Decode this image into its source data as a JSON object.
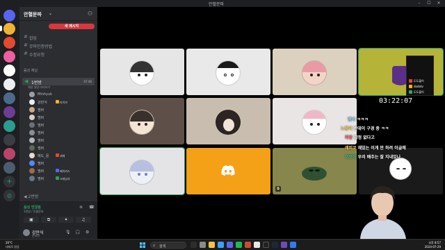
{
  "window": {
    "title": "안혈문파"
  },
  "server": {
    "name": "안혈문파",
    "new_badge": "새 메시지"
  },
  "channels": [
    {
      "label": "잡담"
    },
    {
      "label": "뮤파인증방법"
    },
    {
      "label": "수정요청"
    }
  ],
  "voice_category": "음성 채널",
  "voice_channel": {
    "label": "1번방",
    "time": "07:46",
    "sub": "채널 설명 미리보기"
  },
  "members": [
    {
      "name": "Minhyuk",
      "tag": ""
    },
    {
      "name": "강만식",
      "tag": "라이브"
    },
    {
      "name": "멤버",
      "tag": ""
    },
    {
      "name": "멤버",
      "tag": ""
    },
    {
      "name": "멤버",
      "tag": ""
    },
    {
      "name": "멤버",
      "tag": ""
    },
    {
      "name": "멤버",
      "tag": ""
    },
    {
      "name": "멤버",
      "tag": ""
    },
    {
      "name": "메도_뭉",
      "tag": "세계"
    },
    {
      "name": "멤버",
      "tag": ""
    },
    {
      "name": "멤버",
      "tag": "메이커스"
    },
    {
      "name": "멤버",
      "tag": "고레상사"
    }
  ],
  "voice_channel_2": "2번방",
  "voice_bar": {
    "status": "음성 연결됨",
    "sub": "1번방 / 안혈문파"
  },
  "user": {
    "name": "강만식",
    "status": "온라인"
  },
  "stream": {
    "clock": "03:22:07",
    "sponsors": [
      {
        "label": "도도불이",
        "color": "#e34a2f"
      },
      {
        "label": "dodotv",
        "color": "#f6b500"
      },
      {
        "label": "도도불이",
        "color": "#3ea35f"
      }
    ],
    "chat": [
      {
        "name": "멤버",
        "text": "ㅋㅋㅋ",
        "color": "#9ad3ff"
      },
      {
        "name": "노랑이",
        "text": "반데이 구경 중 ㅋㅋ",
        "color": "#f7d84a"
      },
      {
        "name": "파랑",
        "text": "감정 없다고",
        "color": "#ff6161"
      },
      {
        "name": "레피코",
        "text": "재밌는 이게 안 하려 이글에",
        "color": "#ffd76b"
      },
      {
        "name": "이모이",
        "text": "우리 배추는 잘 지내있나",
        "color": "#4ccf9a"
      }
    ]
  },
  "taskbar": {
    "weather": "20°C",
    "weather_sub": "대체로 맑음",
    "search": "검색",
    "time": "오후 8:57",
    "date": "2024-07-29"
  }
}
